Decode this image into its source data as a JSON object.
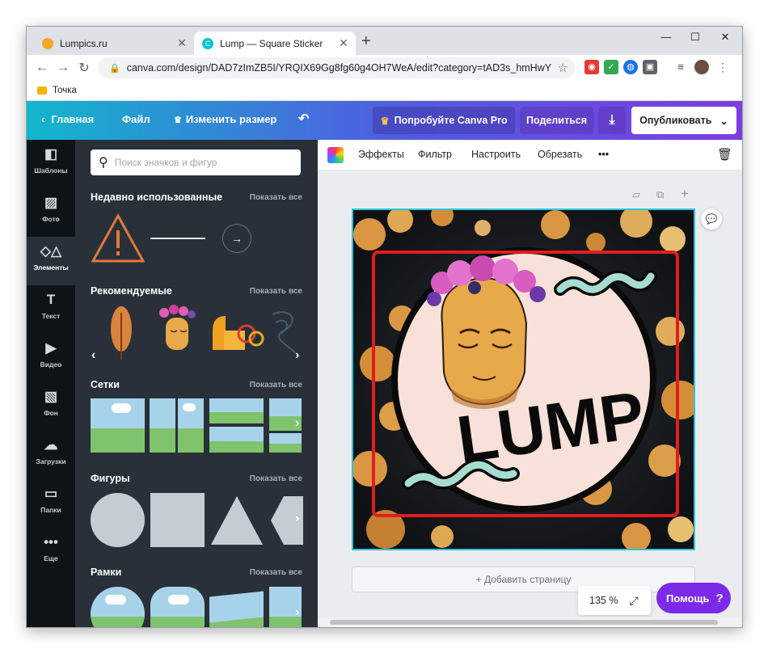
{
  "browser": {
    "tabs": [
      {
        "title": "Lumpics.ru",
        "active": false
      },
      {
        "title": "Lump — Square Sticker",
        "active": true
      }
    ],
    "new_tab": "+",
    "controls": {
      "minimize": "—",
      "maximize": "☐",
      "close": "✕"
    },
    "url": "canva.com/design/DAD7zImZB5I/YRQIX69Gg8fg60g4OH7WeA/edit?category=tAD3s_hmHwY",
    "bookmark": "Точка"
  },
  "topbar": {
    "home": "Главная",
    "file": "Файл",
    "resize": "Изменить размер",
    "try_pro": "Попробуйте Canva Pro",
    "share": "Поделиться",
    "publish": "Опубликовать"
  },
  "rail": [
    {
      "label": "Шаблоны",
      "icon": "templates-icon"
    },
    {
      "label": "Фото",
      "icon": "photo-icon"
    },
    {
      "label": "Элементы",
      "icon": "elements-icon",
      "active": true
    },
    {
      "label": "Текст",
      "icon": "text-icon"
    },
    {
      "label": "Видео",
      "icon": "video-icon"
    },
    {
      "label": "Фон",
      "icon": "background-icon"
    },
    {
      "label": "Загрузки",
      "icon": "uploads-icon"
    },
    {
      "label": "Папки",
      "icon": "folders-icon"
    },
    {
      "label": "Еще",
      "icon": "more-icon"
    }
  ],
  "panel": {
    "search_placeholder": "Поиск значков и фигур",
    "show_all": "Показать все",
    "sections": {
      "recent": "Недавно использованные",
      "recommended": "Рекомендуемые",
      "grids": "Сетки",
      "shapes": "Фигуры",
      "frames": "Рамки"
    }
  },
  "edit_toolbar": {
    "effects": "Эффекты",
    "filter": "Фильтр",
    "adjust": "Настроить",
    "crop": "Обрезать",
    "more": "•••"
  },
  "canvas": {
    "sticker_text": "LUMP",
    "add_page": "+ Добавить страницу",
    "zoom": "135 %",
    "help": "Помощь",
    "help_icon": "?"
  },
  "colors": {
    "accent": "#7c2ae8",
    "selection": "#2ec4d6",
    "highlight_frame": "#e01e1e"
  }
}
